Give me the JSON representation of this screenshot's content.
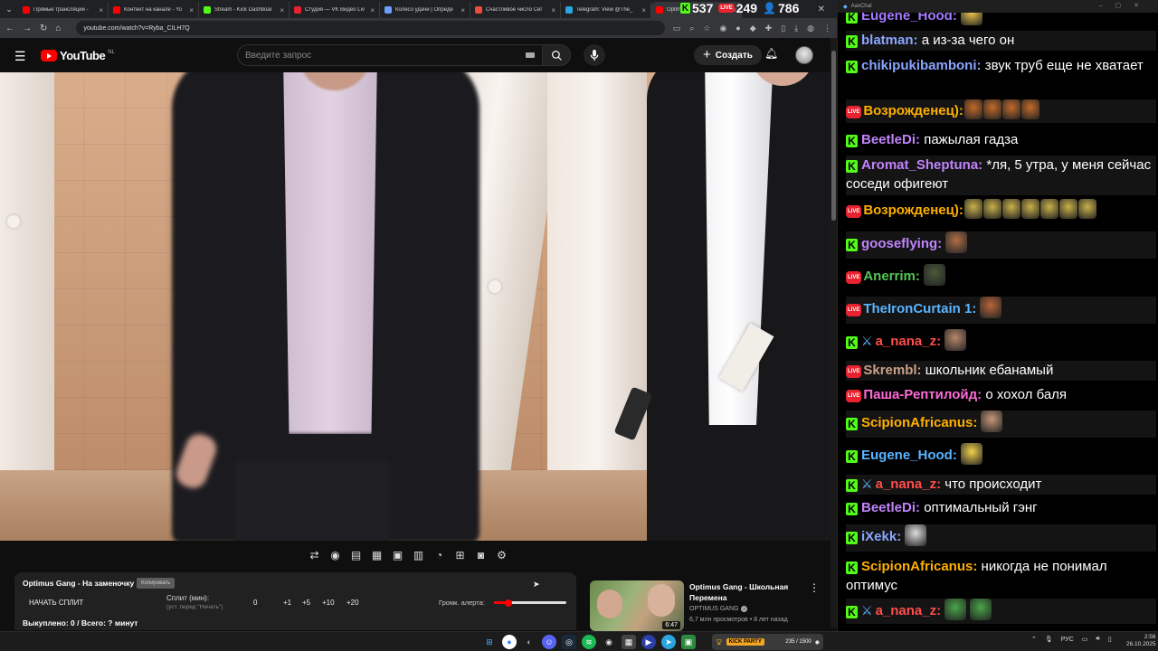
{
  "browser": {
    "tabs": [
      {
        "label": "Прямые трансляции - ",
        "color": "#ff0000"
      },
      {
        "label": "Контент на канале - Yo",
        "color": "#ff0000"
      },
      {
        "label": "Stream - Kick Dashboar",
        "color": "#53fc18"
      },
      {
        "label": "Студия — VK Видео Liv",
        "color": "#e8232f"
      },
      {
        "label": "Колесо удачи | Опреде",
        "color": "#6aa0ff"
      },
      {
        "label": "Счастливое число Сег",
        "color": "#e84c3d"
      },
      {
        "label": "Telegram: View @The_",
        "color": "#2aa5e0"
      },
      {
        "label": "Optimus",
        "color": "#ff0000"
      }
    ],
    "url": "youtube.com/watch?v=Ryba_CILH7Q"
  },
  "stream_stats": {
    "kick_viewers": "537",
    "vk_viewers": "249",
    "vk_live_label": "LIVE",
    "total_viewers": "786"
  },
  "youtube": {
    "logo_text": "YouTube",
    "region": "NL",
    "search_placeholder": "Введите запрос",
    "create_label": "Создать"
  },
  "split_panel": {
    "title": "Optimus Gang - На заменочку",
    "grey_button": "Копировать",
    "start_label": "НАЧАТЬ СПЛИТ",
    "split_label": "Сплит (мин):",
    "split_hint": "(уст. перед \"Начать\")",
    "split_value": "0",
    "increments": [
      "+1",
      "+5",
      "+10",
      "+20"
    ],
    "volume_label": "Громк. алерта:",
    "volume_level": 0.2,
    "bought_text": "Выкуплено: 0 / Всего: ? минут"
  },
  "recommendation": {
    "title": "Optimus Gang - Школьная Перемена",
    "channel": "OPTIMUS GANG",
    "views": "6,7 млн просмотров",
    "age": "8 лет назад",
    "duration": "6:47"
  },
  "chat": {
    "window_title": "AaxChat",
    "messages": [
      {
        "badges": [
          "kick"
        ],
        "nick": "Eugene_Hood:",
        "color": "#a57bff",
        "text": "",
        "emotes": [
          "#f2c94c"
        ]
      },
      {
        "badges": [
          "kick"
        ],
        "nick": "blatman:",
        "color": "#8aa6ff",
        "text": "а из-за чего он",
        "emotes": []
      },
      {
        "badges": [
          "kick"
        ],
        "nick": "chikipukibamboni:",
        "color": "#8aa6ff",
        "text": "звук труб еще не хватает",
        "emotes": []
      },
      {
        "badges": [
          "vk"
        ],
        "nick": "Возрожденец):",
        "color": "#ffb000",
        "text": "",
        "emotes": [
          "#c26a2a",
          "#c26a2a",
          "#c26a2a",
          "#c26a2a"
        ]
      },
      {
        "badges": [
          "kick"
        ],
        "nick": "BeetleDi:",
        "color": "#c084fc",
        "text": "пажылая гадза",
        "emotes": []
      },
      {
        "badges": [
          "kick"
        ],
        "nick": "Aromat_Sheptuna:",
        "color": "#c084fc",
        "text": "*ля, 5 утра, у меня сейчас соседи офигеют",
        "emotes": []
      },
      {
        "badges": [
          "vk"
        ],
        "nick": "Возрожденец):",
        "color": "#ffb000",
        "text": "",
        "emotes": [
          "#c9b04a",
          "#c9b04a",
          "#c9b04a",
          "#c9b04a",
          "#c9b04a",
          "#c9b04a",
          "#c9b04a"
        ]
      },
      {
        "badges": [
          "kick"
        ],
        "nick": "gooseflying:",
        "color": "#c084fc",
        "text": "",
        "emotes": [
          "#b0704a"
        ]
      },
      {
        "badges": [
          "vk"
        ],
        "nick": "Anerrim:",
        "color": "#53c653",
        "text": "",
        "emotes": [
          "#4a5a3a"
        ]
      },
      {
        "badges": [
          "vk"
        ],
        "nick": "TheIronCurtain 1:",
        "color": "#5ab4ff",
        "text": "",
        "emotes": [
          "#b8663a"
        ]
      },
      {
        "badges": [
          "kick",
          "sword"
        ],
        "nick": "a_nana_z:",
        "color": "#ff4d4d",
        "text": "",
        "emotes": [
          "#b7886a"
        ]
      },
      {
        "badges": [
          "vk"
        ],
        "nick": "Skrembl:",
        "color": "#c9a08a",
        "text": "школьник ебанамый",
        "emotes": []
      },
      {
        "badges": [
          "vk"
        ],
        "nick": "Паша-Рептилойд:",
        "color": "#ff6bd6",
        "text": "о хохол баля",
        "emotes": []
      },
      {
        "badges": [
          "kick"
        ],
        "nick": "ScipionAfricanus:",
        "color": "#ffb000",
        "text": "",
        "emotes": [
          "#c7987a"
        ]
      },
      {
        "badges": [
          "kick"
        ],
        "nick": "Eugene_Hood:",
        "color": "#5ab4ff",
        "text": "",
        "emotes": [
          "#f2d24c"
        ]
      },
      {
        "badges": [
          "kick",
          "sword"
        ],
        "nick": "a_nana_z:",
        "color": "#ff4d4d",
        "text": "что происходит",
        "emotes": []
      },
      {
        "badges": [
          "kick"
        ],
        "nick": "BeetleDi:",
        "color": "#c084fc",
        "text": "оптимальный гэнг",
        "emotes": []
      },
      {
        "badges": [
          "kick"
        ],
        "nick": "iXekk:",
        "color": "#8aa6ff",
        "text": "",
        "emotes": [
          "#dddddd"
        ]
      },
      {
        "badges": [
          "kick"
        ],
        "nick": "ScipionAfricanus:",
        "color": "#ffb000",
        "text": "никогда не понимал оптимус",
        "emotes": []
      },
      {
        "badges": [
          "kick",
          "sword"
        ],
        "nick": "a_nana_z:",
        "color": "#ff4d4d",
        "text": "",
        "emotes": [
          "#4aa64a",
          "#4aa64a"
        ]
      }
    ]
  },
  "taskbar": {
    "kick_party_label": "KICK PARTY",
    "kick_party_counter": "235 / 1500",
    "lang": "РУС",
    "time": "2:56",
    "date": "26.10.2025"
  }
}
